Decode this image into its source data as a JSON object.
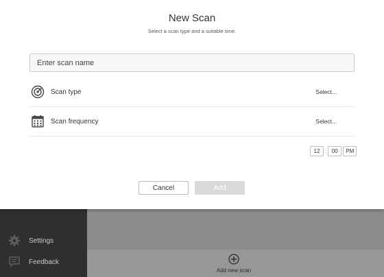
{
  "modal": {
    "title": "New Scan",
    "subtitle": "Select a scan type and a suitable time.",
    "name_placeholder": "Enter scan name",
    "rows": [
      {
        "label": "Scan type",
        "action": "Select...",
        "icon": "radar-icon"
      },
      {
        "label": "Scan frequency",
        "action": "Select...",
        "icon": "calendar-icon"
      }
    ],
    "time": {
      "hour": "12",
      "separator": ":",
      "minute": "00",
      "period": "PM"
    },
    "buttons": {
      "cancel": "Cancel",
      "add": "Add"
    }
  },
  "sidebar": {
    "items": [
      {
        "label": "Settings",
        "icon": "gear-icon"
      },
      {
        "label": "Feedback",
        "icon": "feedback-icon"
      }
    ]
  },
  "main": {
    "add_new_scan": "Add new scan",
    "add_icon": "plus-circle-icon"
  },
  "colors": {
    "sidebar_bg": "#2f2f2f",
    "overlay": "#8b8b8b",
    "modal_bg": "#ffffff",
    "add_disabled": "#d9d9d9"
  }
}
